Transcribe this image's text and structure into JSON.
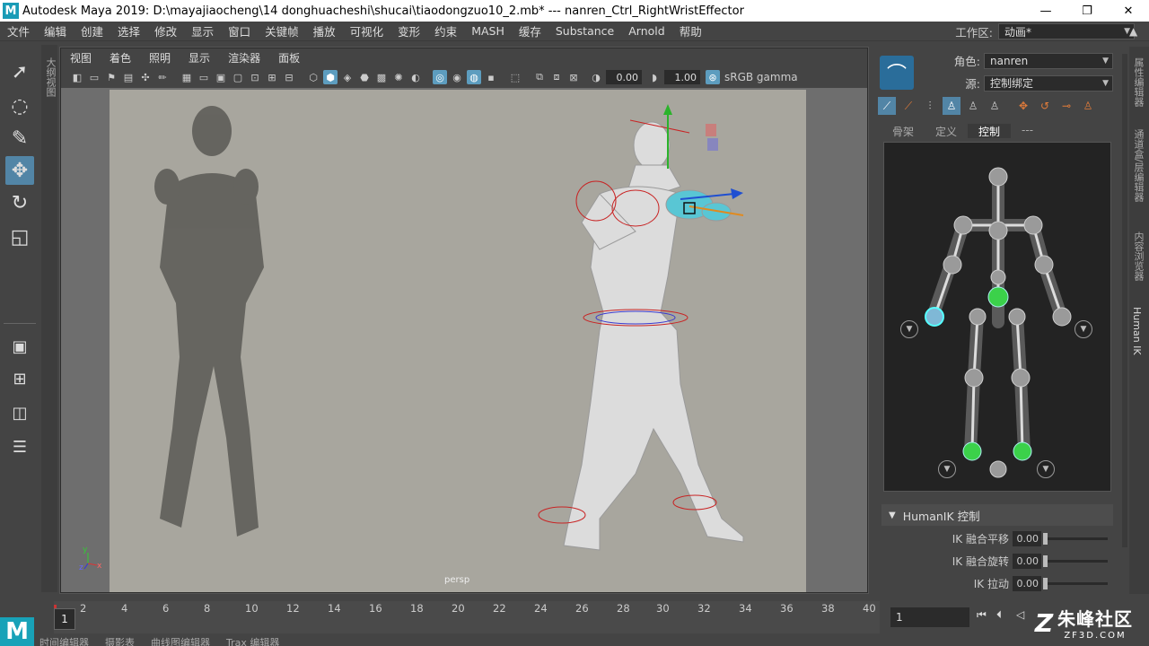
{
  "titlebar": {
    "logo": "M",
    "title": "Autodesk Maya 2019: D:\\mayajiaocheng\\14 donghuacheshi\\shucai\\tiaodongzuo10_2.mb*    ---    nanren_Ctrl_RightWristEffector",
    "minimize": "—",
    "restore": "❐",
    "close": "✕"
  },
  "menubar": [
    "文件",
    "编辑",
    "创建",
    "选择",
    "修改",
    "显示",
    "窗口",
    "关键帧",
    "播放",
    "可视化",
    "变形",
    "约束",
    "MASH",
    "缓存",
    "Substance",
    "Arnold",
    "帮助"
  ],
  "workspace": {
    "label": "工作区:",
    "value": "动画*"
  },
  "outliner_tab": "大纲视图",
  "viewport": {
    "menu": [
      "视图",
      "着色",
      "照明",
      "显示",
      "渲染器",
      "面板"
    ],
    "exposure": "0.00",
    "gamma": "1.00",
    "colorspace": "sRGB gamma",
    "camera": "persp",
    "axis_y": "y",
    "axis_z": "z",
    "axis_x": "x"
  },
  "humanik": {
    "character_label": "角色:",
    "character_value": "nanren",
    "source_label": "源:",
    "source_value": "控制绑定",
    "tabs": [
      "骨架",
      "定义",
      "控制",
      "---"
    ],
    "active_tab": 2,
    "controls_header": "HumanIK 控制",
    "sliders": [
      {
        "label": "IK 融合平移",
        "value": "0.00"
      },
      {
        "label": "IK 融合旋转",
        "value": "0.00"
      },
      {
        "label": "IK 拉动",
        "value": "0.00"
      }
    ]
  },
  "side_tabs": [
    "属性编辑器",
    "通道盒/层编辑器",
    "内容浏览器",
    "Human IK"
  ],
  "timeline": {
    "current_frame": "1",
    "ticks": [
      "2",
      "4",
      "6",
      "8",
      "10",
      "12",
      "14",
      "16",
      "18",
      "20",
      "22",
      "24",
      "26",
      "28",
      "30",
      "32",
      "34",
      "36",
      "38",
      "40"
    ],
    "frame_field": "1"
  },
  "bottom_tabs": [
    "时间编辑器",
    "摄影表",
    "曲线图编辑器",
    "Trax 编辑器"
  ],
  "watermark": {
    "cn": "朱峰社区",
    "en": "ZF3D.COM"
  },
  "colors": {
    "accent": "#5285a6",
    "maya_teal": "#18a2b8",
    "ik_green": "#3bd14a"
  }
}
